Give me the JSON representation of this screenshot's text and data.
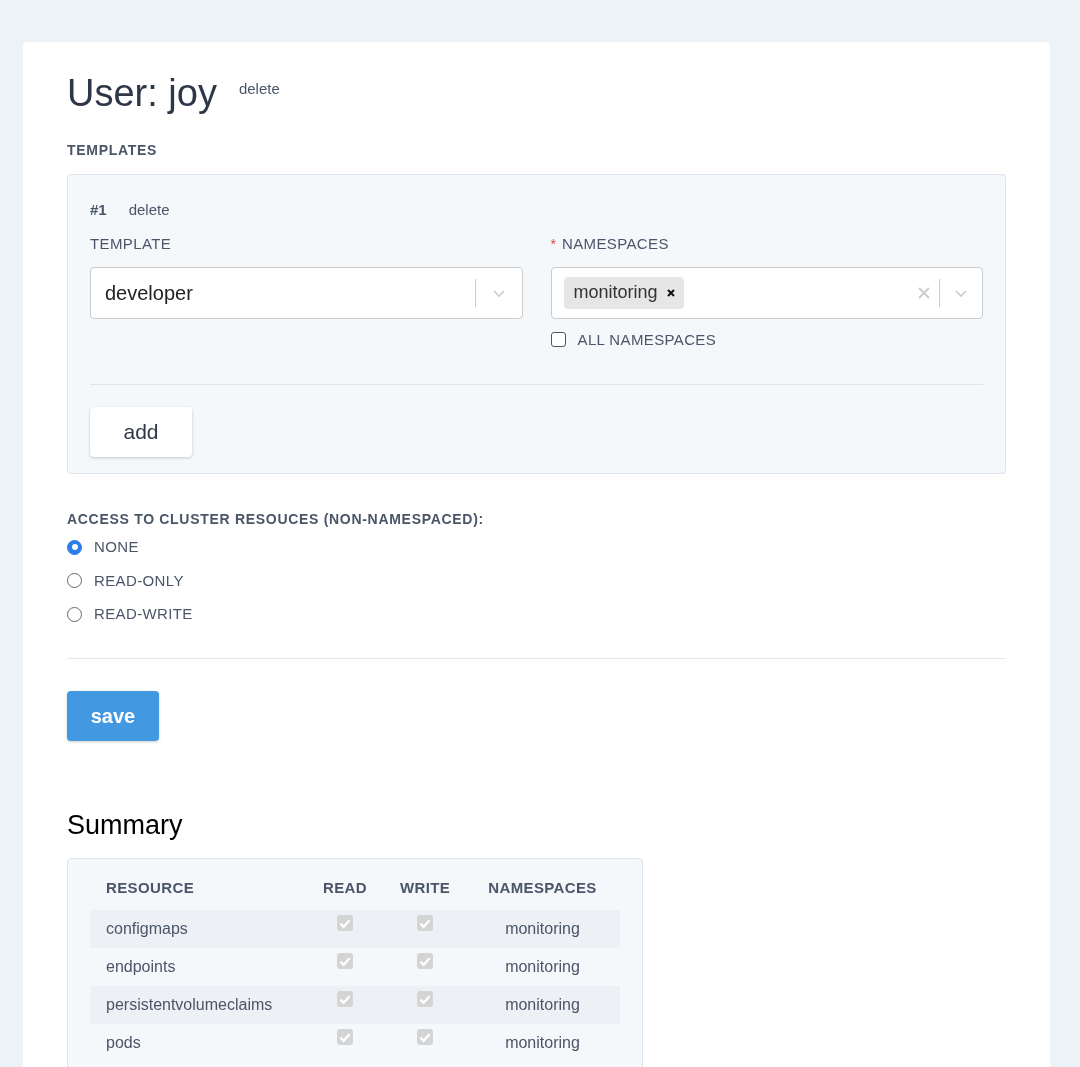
{
  "title": "User: joy",
  "title_action": "delete",
  "templates": {
    "heading": "TEMPLATES",
    "items": [
      {
        "number": "#1",
        "action": "delete",
        "template_label": "TEMPLATE",
        "template_value": "developer",
        "namespaces_label": "NAMESPACES",
        "required_mark": "*",
        "namespaces": [
          "monitoring"
        ],
        "all_namespaces": {
          "label": "ALL NAMESPACES",
          "checked": false
        }
      }
    ],
    "add_button": "add"
  },
  "cluster_access": {
    "heading": "ACCESS TO CLUSTER RESOUCES (NON-NAMESPACED):",
    "options": [
      {
        "label": "NONE",
        "selected": true
      },
      {
        "label": "READ-ONLY",
        "selected": false
      },
      {
        "label": "READ-WRITE",
        "selected": false
      }
    ]
  },
  "save_button": "save",
  "summary": {
    "title": "Summary",
    "columns": [
      "RESOURCE",
      "READ",
      "WRITE",
      "NAMESPACES"
    ],
    "rows": [
      {
        "resource": "configmaps",
        "read": true,
        "write": true,
        "disabled": true,
        "namespaces": "monitoring"
      },
      {
        "resource": "endpoints",
        "read": true,
        "write": true,
        "disabled": true,
        "namespaces": "monitoring"
      },
      {
        "resource": "persistentvolumeclaims",
        "read": true,
        "write": true,
        "disabled": true,
        "namespaces": "monitoring"
      },
      {
        "resource": "pods",
        "read": true,
        "write": true,
        "disabled": true,
        "namespaces": "monitoring"
      }
    ]
  }
}
